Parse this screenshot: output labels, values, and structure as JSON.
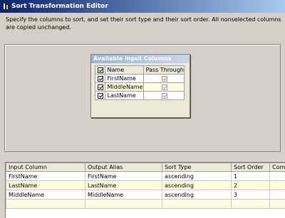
{
  "window": {
    "title": "Sort Transformation Editor"
  },
  "description": "Specify the columns to sort, and set their sort type and their sort order. All nonselected columns are copied unchanged.",
  "available_columns": {
    "title": "Available Input Columns",
    "headers": {
      "name": "Name",
      "pass_through": "Pass Through"
    },
    "rows": [
      {
        "name": "FirstName",
        "selected": true,
        "pass_through": true
      },
      {
        "name": "MiddleName",
        "selected": true,
        "pass_through": true
      },
      {
        "name": "LastName",
        "selected": true,
        "pass_through": true
      }
    ]
  },
  "sort_grid": {
    "headers": [
      "Input Column",
      "Output Alias",
      "Sort Type",
      "Sort Order",
      "Com"
    ],
    "rows": [
      {
        "input": "FirstName",
        "alias": "FirstName",
        "type": "ascending",
        "order": "1",
        "comparison": ""
      },
      {
        "input": "LastName",
        "alias": "LastName",
        "type": "ascending",
        "order": "2",
        "comparison": ""
      },
      {
        "input": "MiddleName",
        "alias": "MiddleName",
        "type": "ascending",
        "order": "3",
        "comparison": ""
      }
    ]
  }
}
